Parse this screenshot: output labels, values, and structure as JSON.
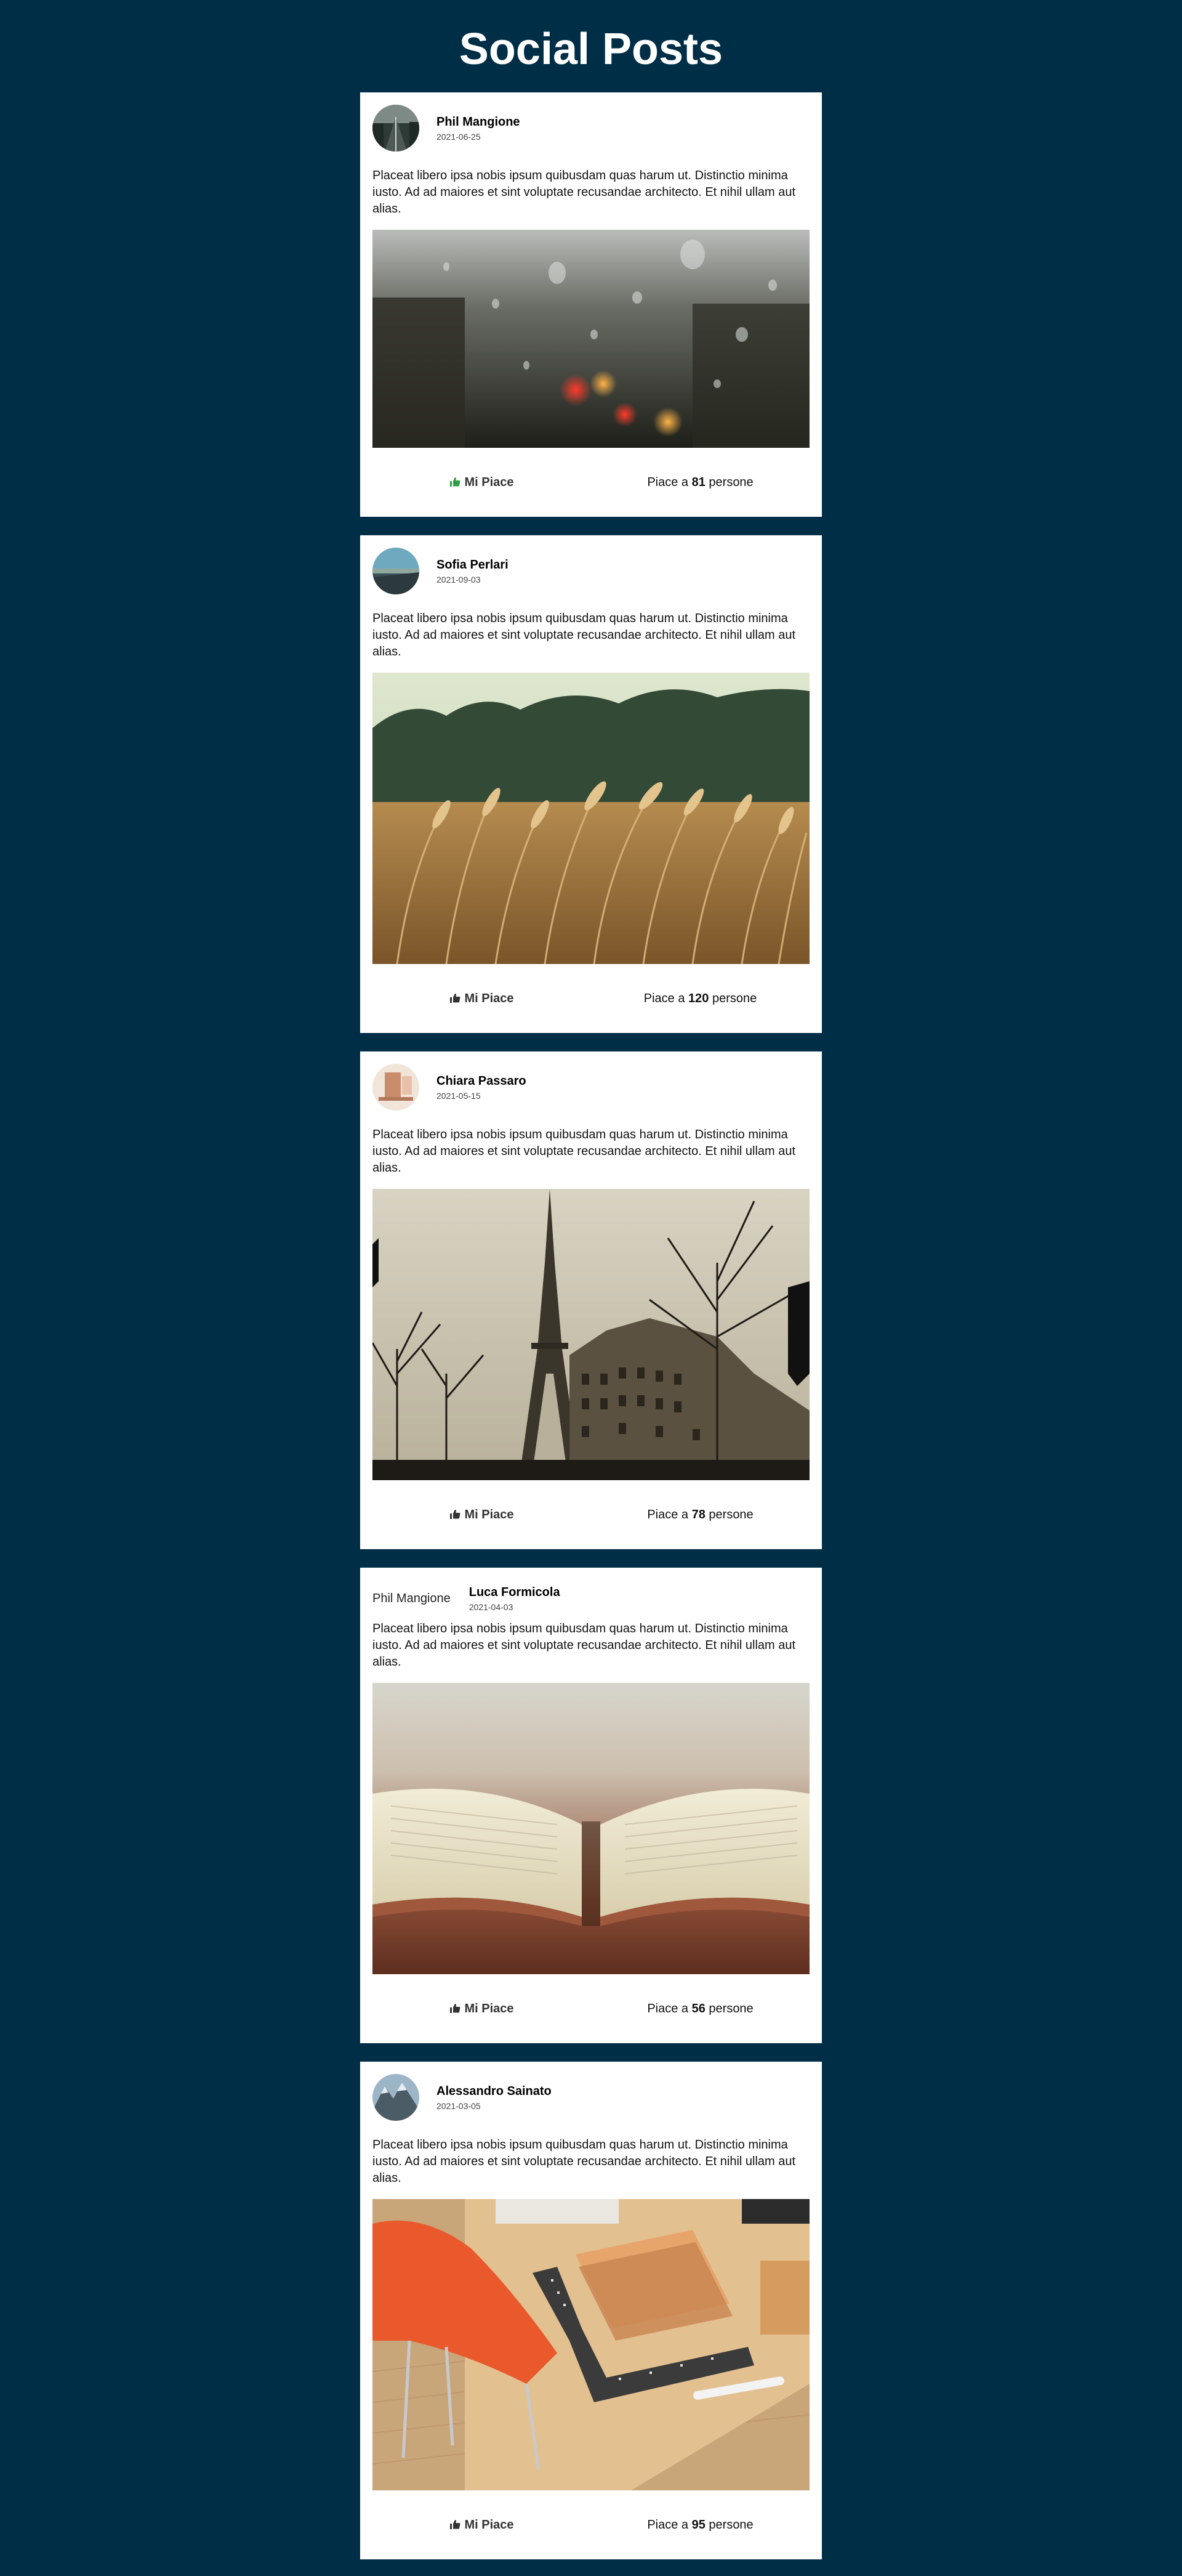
{
  "page_title": "Social Posts",
  "like_button_label": "Mi Piace",
  "likes_prefix": "Piace a",
  "likes_suffix": "persone",
  "colors": {
    "background": "#002e47",
    "liked_icon": "#2f9e44",
    "card": "#ffffff"
  },
  "posts": [
    {
      "author": "Phil Mangione",
      "date": "2021-06-25",
      "text": "Placeat libero ipsa nobis ipsum quibusdam quas harum ut. Distinctio minima iusto. Ad ad maiores et sint voluptate recusandae architecto. Et nihil ullam aut alias.",
      "likes": "81",
      "liked": true,
      "avatar_fallback": "",
      "avatar_icon": "city-road-photo",
      "image_icon": "rain-drops-window-photo"
    },
    {
      "author": "Sofia Perlari",
      "date": "2021-09-03",
      "text": "Placeat libero ipsa nobis ipsum quibusdam quas harum ut. Distinctio minima iusto. Ad ad maiores et sint voluptate recusandae architecto. Et nihil ullam aut alias.",
      "likes": "120",
      "liked": false,
      "avatar_fallback": "",
      "avatar_icon": "coastline-photo",
      "image_icon": "wheat-field-photo"
    },
    {
      "author": "Chiara Passaro",
      "date": "2021-05-15",
      "text": "Placeat libero ipsa nobis ipsum quibusdam quas harum ut. Distinctio minima iusto. Ad ad maiores et sint voluptate recusandae architecto. Et nihil ullam aut alias.",
      "likes": "78",
      "liked": false,
      "avatar_fallback": "",
      "avatar_icon": "room-photo",
      "image_icon": "eiffel-tower-photo"
    },
    {
      "author": "Luca Formicola",
      "date": "2021-04-03",
      "text": "Placeat libero ipsa nobis ipsum quibusdam quas harum ut. Distinctio minima iusto. Ad ad maiores et sint voluptate recusandae architecto. Et nihil ullam aut alias.",
      "likes": "56",
      "liked": false,
      "avatar_fallback": "Phil Mangione",
      "avatar_icon": "",
      "image_icon": "open-book-photo"
    },
    {
      "author": "Alessandro Sainato",
      "date": "2021-03-05",
      "text": "Placeat libero ipsa nobis ipsum quibusdam quas harum ut. Distinctio minima iusto. Ad ad maiores et sint voluptate recusandae architecto. Et nihil ullam aut alias.",
      "likes": "95",
      "liked": false,
      "avatar_fallback": "",
      "avatar_icon": "mountain-photo",
      "image_icon": "desk-workspace-photo"
    }
  ]
}
